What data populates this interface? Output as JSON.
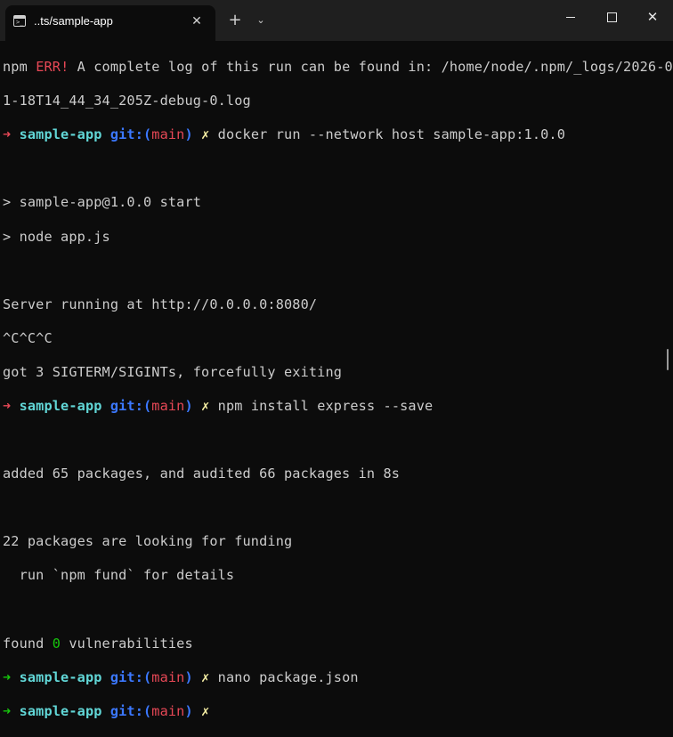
{
  "window": {
    "tab_title": "..ts/sample-app",
    "tab_icon": "terminal-icon",
    "close_tab_glyph": "✕",
    "new_tab_glyph": "+",
    "dropdown_glyph": "⌄",
    "close_glyph": "✕"
  },
  "colors": {
    "error": "#e74856",
    "prompt_ok": "#16c60c",
    "dir": "#61d6d6",
    "git": "#3b78ff",
    "dirty": "#f9f1a5"
  },
  "terminal": {
    "err_prefix": "npm ",
    "err_label": "ERR!",
    "err_message": " A complete log of this run can be found in: /home/node/.npm/_logs/2026-0",
    "err_message_cont": "1-18T14_44_34_205Z-debug-0.log",
    "prompt_arrow": "➜",
    "prompt_dir": "sample-app",
    "git_prefix": "git:(",
    "git_branch": "main",
    "git_suffix": ")",
    "dirty_mark": "✗",
    "cmd1": "docker run --network host sample-app:1.0.0",
    "out1": "> sample-app@1.0.0 start",
    "out2": "> node app.js",
    "out3": "Server running at http://0.0.0.0:8080/",
    "out4": "^C^C^C",
    "out5": "got 3 SIGTERM/SIGINTs, forcefully exiting",
    "cmd2": "npm install express --save",
    "out6": "added 65 packages, and audited 66 packages in 8s",
    "out7": "22 packages are looking for funding",
    "out8": "  run `npm fund` for details",
    "out9_prefix": "found ",
    "out9_count": "0",
    "out9_suffix": " vulnerabilities",
    "cmd3": "nano package.json"
  }
}
